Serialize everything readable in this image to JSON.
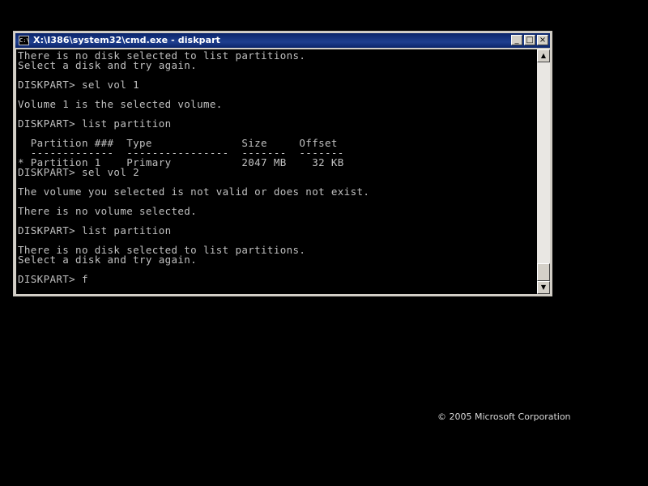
{
  "window": {
    "title": "X:\\I386\\system32\\cmd.exe - diskpart",
    "icon_text": "C:\\",
    "minimize_glyph": "_",
    "maximize_glyph": "□",
    "close_glyph": "×"
  },
  "console": {
    "text": "There is no disk selected to list partitions.\nSelect a disk and try again.\n\nDISKPART> sel vol 1\n\nVolume 1 is the selected volume.\n\nDISKPART> list partition\n\n  Partition ###  Type              Size     Offset\n  -------------  ----------------  -------  -------\n* Partition 1    Primary           2047 MB    32 KB\nDISKPART> sel vol 2\n\nThe volume you selected is not valid or does not exist.\n\nThere is no volume selected.\n\nDISKPART> list partition\n\nThere is no disk selected to list partitions.\nSelect a disk and try again.\n\nDISKPART> f"
  },
  "scrollbar": {
    "up_glyph": "▲",
    "down_glyph": "▼"
  },
  "footer": {
    "copyright": "© 2005 Microsoft Corporation"
  },
  "colors": {
    "desktop": "#000000",
    "titlebar": "#0a246a",
    "console_bg": "#000000",
    "console_text": "#c0c0c0"
  }
}
